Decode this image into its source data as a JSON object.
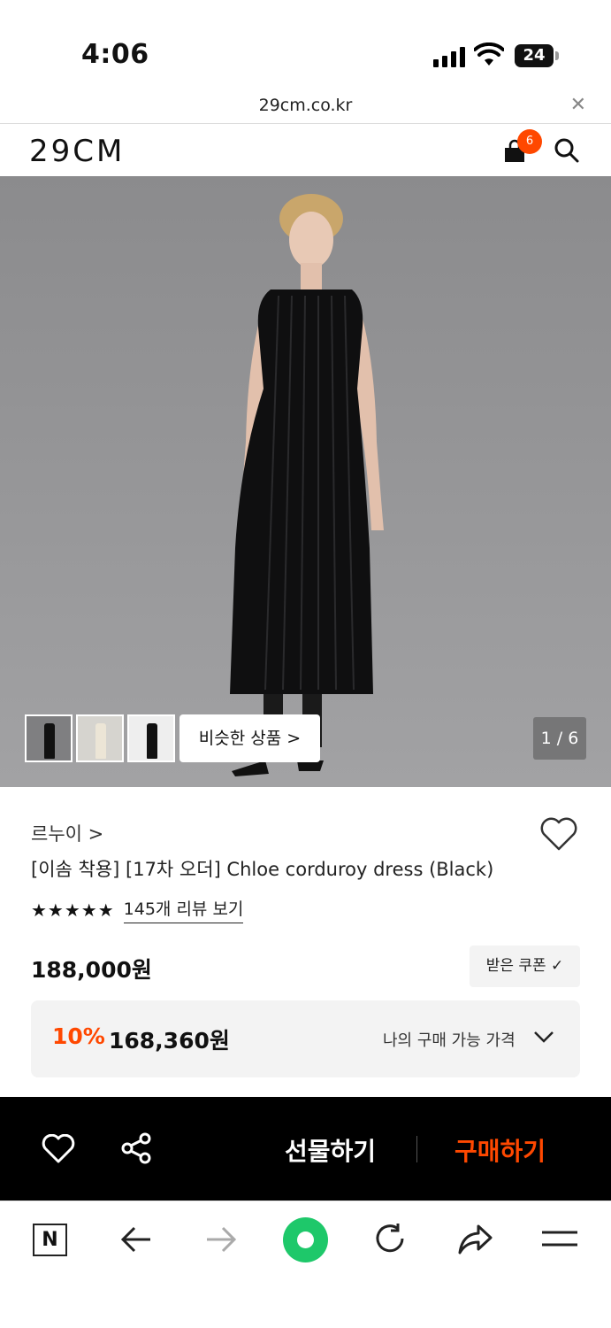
{
  "status_bar": {
    "time": "4:06",
    "battery": "24"
  },
  "url_bar": {
    "url": "29cm.co.kr",
    "close_icon": "close-icon"
  },
  "header": {
    "logo": "29CM",
    "cart_count": "6"
  },
  "hero": {
    "similar_button": "비슷한 상품 >",
    "pager": "1 / 6"
  },
  "product": {
    "brand": "르누이 >",
    "name": "[이솜 착용] [17차 오더] Chloe corduroy dress (Black)",
    "stars": "★★★★★",
    "rating": 4.5,
    "review_link": "145개 리뷰 보기",
    "price": "188,000원",
    "coupon_button": "받은 쿠폰 ✓",
    "discount_percent": "10%",
    "discount_price": "168,360원",
    "my_price_label": "나의 구매 가능 가격"
  },
  "action_bar": {
    "gift_label": "선물하기",
    "buy_label": "구매하기"
  },
  "browser_toolbar": {
    "n_label": "N"
  },
  "colors": {
    "accent": "#ff4800",
    "green": "#1ec86a",
    "dark": "#000000"
  }
}
